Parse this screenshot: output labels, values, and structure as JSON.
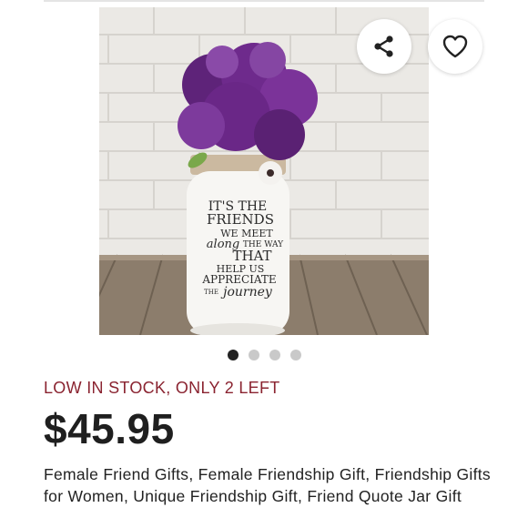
{
  "listing": {
    "stock_notice": "LOW IN STOCK, ONLY 2 LEFT",
    "price": "$45.95",
    "title": "Female Friend Gifts, Female Friendship Gift, Friendship Gifts for Women, Unique Friendship Gift, Friend Quote Jar Gift"
  },
  "photo": {
    "jar_text": {
      "line1": "IT'S THE",
      "line2": "FRIENDS",
      "line3a": "WE MEET",
      "line3b": "along",
      "line3c": "THE WAY",
      "line4": "THAT",
      "line5": "HELP US",
      "line6": "APPRECIATE",
      "line7a": "THE",
      "line7b": "journey"
    }
  },
  "actions": {
    "share_icon": "share-icon",
    "favorite_icon": "heart-icon"
  },
  "carousel": {
    "total_images": 4,
    "active_index": 1
  },
  "colors": {
    "stock_notice": "#8a2330",
    "price": "#1f1f1f",
    "flowers": "#6e2a8c"
  }
}
